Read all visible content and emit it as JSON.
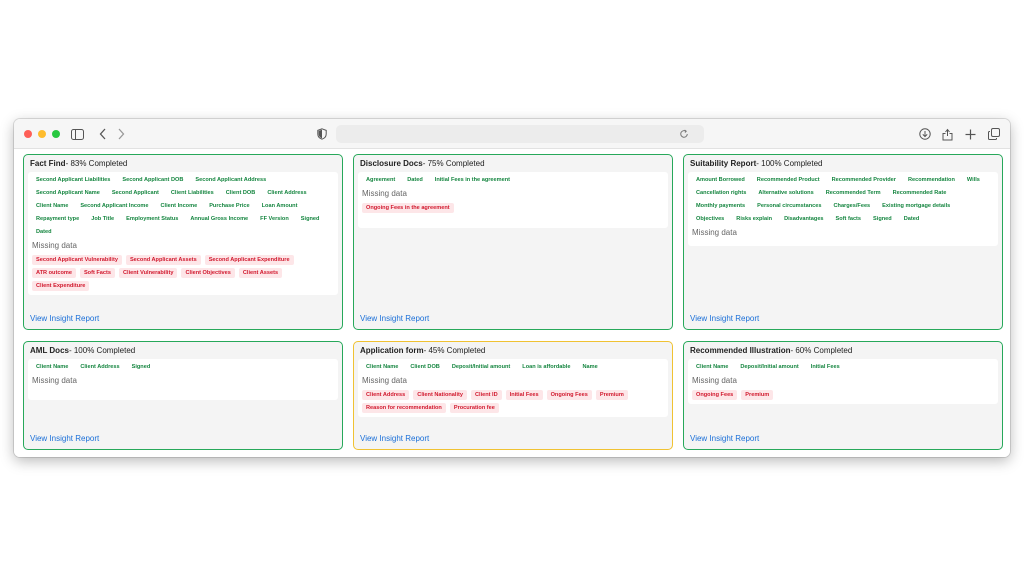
{
  "browser": {
    "address_value": ""
  },
  "cards": [
    {
      "title": "Fact Find",
      "status": " - 83% Completed",
      "present": [
        "Second Applicant Liabilities",
        "Second Applicant DOB",
        "Second Applicant Address",
        "Second Applicant Name",
        "Second Applicant",
        "Client Liabilities",
        "Client DOB",
        "Client Address",
        "Client Name",
        "Second Applicant Income",
        "Client Income",
        "Purchase Price",
        "Loan Amount",
        "Repayment type",
        "Job Title",
        "Employment Status",
        "Annual Gross Income",
        "FF Version",
        "Signed",
        "Dated"
      ],
      "missing_label": "Missing data",
      "missing": [
        "Second Applicant Vulnerability",
        "Second Applicant Assets",
        "Second Applicant Expenditure",
        "ATR outcome",
        "Soft Facts",
        "Client Vulnerability",
        "Client Objectives",
        "Client Assets",
        "Client Expenditure"
      ],
      "link": "View Insight Report"
    },
    {
      "title": "Disclosure Docs",
      "status": " - 75% Completed",
      "present": [
        "Agreement",
        "Dated",
        "Initial Fees in the agreement"
      ],
      "missing_label": "Missing data",
      "missing": [
        "Ongoing Fees in the agreement"
      ],
      "link": "View Insight Report"
    },
    {
      "title": "Suitability Report",
      "status": " - 100% Completed",
      "present": [
        "Amount Borrowed",
        "Recommended Product",
        "Recommended Provider",
        "Recommendation",
        "Wills",
        "Cancellation rights",
        "Alternative solutions",
        "Recommended Term",
        "Recommended Rate",
        "Monthly payments",
        "Personal circumstances",
        "Charges/Fees",
        "Existing mortgage details",
        "Objectives",
        "Risks explain",
        "Disadvantages",
        "Soft facts",
        "Signed",
        "Dated"
      ],
      "missing_label": "Missing data",
      "missing": [],
      "link": "View Insight Report"
    },
    {
      "title": "AML Docs",
      "status": " - 100% Completed",
      "present": [
        "Client Name",
        "Client Address",
        "Signed"
      ],
      "missing_label": "Missing data",
      "missing": [],
      "link": "View Insight Report"
    },
    {
      "title": "Application form",
      "status": " - 45% Completed",
      "present": [
        "Client Name",
        "Client DOB",
        "Deposit/Initial amount",
        "Loan is affordable",
        "Name"
      ],
      "missing_label": "Missing data",
      "missing": [
        "Client Address",
        "Client Nationality",
        "Client ID",
        "Initial Fees",
        "Ongoing Fees",
        "Premium",
        "Reason for recommendation",
        "Procuration fee"
      ],
      "link": "View Insight Report"
    },
    {
      "title": "Recommended Illustration",
      "status": " - 60% Completed",
      "present": [
        "Client Name",
        "Deposit/Initial amount",
        "Initial Fees"
      ],
      "missing_label": "Missing data",
      "missing": [
        "Ongoing Fees",
        "Premium"
      ],
      "link": "View Insight Report"
    }
  ],
  "colors": {
    "complete_border": "#27a85a",
    "warning_border": "#f0c232",
    "ok_text": "#14853f",
    "missing_text": "#d1182d",
    "missing_bg": "#fde6e8",
    "link": "#1a6fd8"
  }
}
